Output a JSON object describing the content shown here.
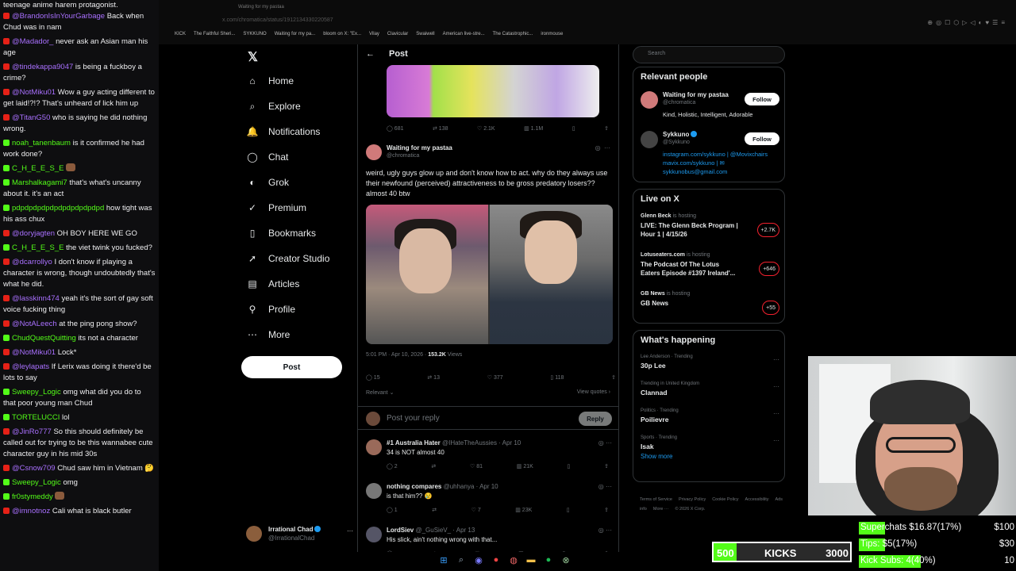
{
  "chat": {
    "top_line": "teenage anime harem protagonist.",
    "messages": [
      {
        "platform": "yt",
        "user": "@BrandonIsInYourGarbage",
        "text": "Back when Chud was in nam"
      },
      {
        "platform": "yt",
        "user": "@Madador_",
        "text": "never ask an Asian man his age"
      },
      {
        "platform": "yt",
        "user": "@tindekappa9047",
        "text": "is being a fuckboy a crime?"
      },
      {
        "platform": "yt",
        "user": "@NotMiku01",
        "text": "Wow a guy acting different to get laid!?!? That's unheard of lick him up"
      },
      {
        "platform": "yt",
        "user": "@TitanG50",
        "text": "who is saying he did nothing wrong."
      },
      {
        "platform": "kick",
        "user": "noah_tanenbaum",
        "text": "is it confirmed he had work done?"
      },
      {
        "platform": "kick",
        "user": "C_H_E_E_S_E",
        "text": "",
        "emote": true
      },
      {
        "platform": "kick",
        "user": "Marshalkagami7",
        "text": "that's what's uncanny about it. it's an act"
      },
      {
        "platform": "kick",
        "user": "pdpdpdpdpdpdpdpdpdpdpd",
        "text": "how tight was his ass chux"
      },
      {
        "platform": "yt",
        "user": "@doryjagten",
        "text": "OH BOY HERE WE GO"
      },
      {
        "platform": "kick",
        "user": "C_H_E_E_S_E",
        "text": "the viet twink you fucked?"
      },
      {
        "platform": "yt",
        "user": "@dcarrollyo",
        "text": "I don't know if playing a character is wrong, though undoubtedly that's what he did."
      },
      {
        "platform": "yt",
        "user": "@lasskinn474",
        "text": "yeah it's the sort of gay soft voice fucking thing"
      },
      {
        "platform": "yt",
        "user": "@NotALeech",
        "text": "at the ping pong show?"
      },
      {
        "platform": "kick",
        "user": "ChudQuestQuitting",
        "text": "its not a character"
      },
      {
        "platform": "yt",
        "user": "@NotMiku01",
        "text": "Lock*"
      },
      {
        "platform": "yt",
        "user": "@leylapats",
        "text": "If Lerix was doing it there'd be lots to say"
      },
      {
        "platform": "kick",
        "user": "Sweepy_Logic",
        "text": "omg what did you do to that poor young man Chud"
      },
      {
        "platform": "kick",
        "user": "TORTELUCCI",
        "text": "lol"
      },
      {
        "platform": "yt",
        "user": "@JinRo777",
        "text": "So this should definitely be called out for trying to be this wannabee cute character guy in his mid 30s"
      },
      {
        "platform": "yt",
        "user": "@Csnow709",
        "text": "Chud saw him in Vietnam 🤔"
      },
      {
        "platform": "kick",
        "user": "Sweepy_Logic",
        "text": "omg"
      },
      {
        "platform": "kick",
        "user": "fr0stymeddy",
        "text": "",
        "emote": true
      },
      {
        "platform": "yt",
        "user": "@imnotnoz",
        "text": "Cali what is black butler"
      }
    ]
  },
  "browser": {
    "tab_title": "Waiting for my pastaa",
    "url": "x.com/chromatica/status/1912134330220587",
    "bookmarks": [
      "KICK",
      "The Faithful Sheri...",
      "SYKKUNO",
      "Waiting for my pa...",
      "bloom on X: \"Ex...",
      "Vilay",
      "Clavicular",
      "Swaiwell",
      "American live-stre...",
      "The Catastrophic...",
      "ironmouse"
    ]
  },
  "nav": {
    "items": [
      {
        "label": "Home",
        "icon": "home-icon",
        "glyph": "⌂"
      },
      {
        "label": "Explore",
        "icon": "search-icon",
        "glyph": "⌕"
      },
      {
        "label": "Notifications",
        "icon": "bell-icon",
        "glyph": "🔔"
      },
      {
        "label": "Chat",
        "icon": "chat-icon",
        "glyph": "◯"
      },
      {
        "label": "Grok",
        "icon": "grok-icon",
        "glyph": "◐"
      },
      {
        "label": "Premium",
        "icon": "premium-icon",
        "glyph": "✓"
      },
      {
        "label": "Bookmarks",
        "icon": "bookmark-icon",
        "glyph": "▯"
      },
      {
        "label": "Creator Studio",
        "icon": "rocket-icon",
        "glyph": "➚"
      },
      {
        "label": "Articles",
        "icon": "articles-icon",
        "glyph": "▤"
      },
      {
        "label": "Profile",
        "icon": "person-icon",
        "glyph": "⚲"
      },
      {
        "label": "More",
        "icon": "more-icon",
        "glyph": "⋯"
      }
    ],
    "post_label": "Post",
    "profile": {
      "name": "Irrational Chad",
      "handle": "@IrrationalChad"
    }
  },
  "post": {
    "header": "Post",
    "prev_stats": [
      "681",
      "138",
      "2.1K",
      "1.1M"
    ],
    "author": {
      "name": "Waiting for my pastaa",
      "handle": "@chromatica"
    },
    "text": "weird, ugly guys glow up and don't know how to act. why do they always use their newfound (perceived) attractiveness to be gross predatory losers?? almost 40 btw",
    "time": "5:01 PM · Apr 10, 2026 · ",
    "views_count": "153.2K",
    "views_label": " Views",
    "stats": {
      "replies": "15",
      "reposts": "13",
      "likes": "377",
      "bookmarks": "118"
    },
    "relevant": "Relevant",
    "view_quotes": "View quotes",
    "reply_placeholder": "Post your reply",
    "reply_button": "Reply",
    "replies": [
      {
        "name": "#1 Australia Hater",
        "handle": "@IHateTheAussies · Apr 10",
        "text": "34 is NOT almost 40",
        "stats": [
          "2",
          "",
          "81",
          "21K"
        ]
      },
      {
        "name": "nothing compares",
        "handle": "@uhhanya · Apr 10",
        "text": "is that him?? 😢",
        "stats": [
          "1",
          "",
          "7",
          "23K"
        ]
      },
      {
        "name": "LordSiev",
        "handle": "@_GuSieV_ · Apr 13",
        "text": "His slick, ain't nothing wrong with that...",
        "stats": [
          "",
          "",
          "",
          ""
        ]
      }
    ]
  },
  "sidebar": {
    "search_placeholder": "Search",
    "relevant_title": "Relevant people",
    "people": [
      {
        "name": "Waiting for my pastaa",
        "handle": "@chromatica",
        "bio": "Kind, Holistic, Intelligent, Adorable",
        "follow": "Follow"
      },
      {
        "name": "Sykkuno",
        "handle": "@Sykkuno",
        "bio_links": "instagram.com/sykkuno | @Movixchairs mavix.com/sykkuno | ✉ sykkunobus@gmail.com",
        "follow": "Follow"
      }
    ],
    "live_title": "Live on X",
    "live": [
      {
        "host": "Glenn Beck",
        "suffix": " is hosting",
        "title": "LIVE: The Glenn Beck Program | Hour 1 | 4/15/26",
        "count": "+2.7K"
      },
      {
        "host": "Lotuseaters.com",
        "suffix": " is hosting",
        "title": "The Podcast Of The Lotus Eaters Episode #1397 Ireland'...",
        "count": "+646"
      },
      {
        "host": "GB News",
        "suffix": " is hosting",
        "title": "GB News",
        "count": "+55"
      }
    ],
    "trending_title": "What's happening",
    "trends": [
      {
        "cat": "Lee Anderson · Trending",
        "title": "30p Lee"
      },
      {
        "cat": "Trending in United Kingdom",
        "title": "Clannad"
      },
      {
        "cat": "Politics · Trending",
        "title": "Poilievre"
      },
      {
        "cat": "Sports · Trending",
        "title": "Isak"
      }
    ],
    "show_more": "Show more",
    "footer": [
      "Terms of Service",
      "Privacy Policy",
      "Cookie Policy",
      "Accessibility",
      "Ads info",
      "More ···",
      "© 2026 X Corp."
    ]
  },
  "overlay": {
    "kicks": {
      "left": "500",
      "label": "KICKS",
      "right": "3000",
      "progress": 0.17
    },
    "goals": [
      {
        "label": "Superchats $16.87(17%)",
        "target": "$100",
        "progress": 0.17
      },
      {
        "label": "Tips: $5(17%)",
        "target": "$30",
        "progress": 0.17
      },
      {
        "label": "Kick Subs: 4(40%)",
        "target": "10",
        "progress": 0.4
      }
    ]
  },
  "colors": {
    "accent": "#1d9bf0",
    "kick": "#53fc18",
    "youtube": "#e62117",
    "background": "#000000"
  }
}
